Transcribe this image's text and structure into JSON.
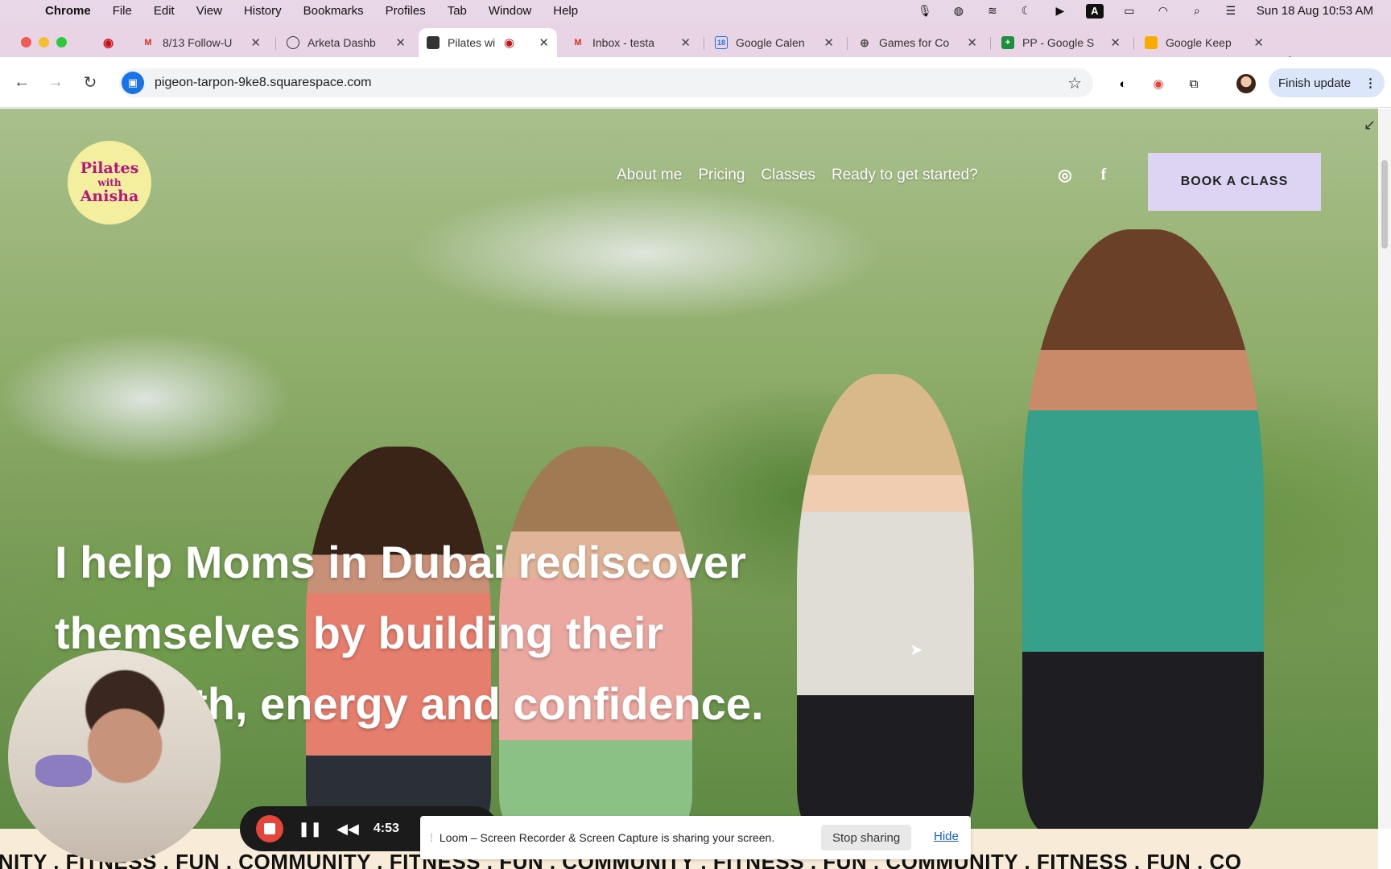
{
  "menubar": {
    "app": "Chrome",
    "items": [
      "File",
      "Edit",
      "View",
      "History",
      "Bookmarks",
      "Profiles",
      "Tab",
      "Window",
      "Help"
    ],
    "clock": "Sun 18 Aug  10:53 AM"
  },
  "tabs": [
    {
      "title": "",
      "icon": "record-icon"
    },
    {
      "title": "8/13 Follow-U",
      "icon": "gmail-icon"
    },
    {
      "title": "Arketa Dashb",
      "icon": "arketa-icon"
    },
    {
      "title": "Pilates wi",
      "icon": "squarespace-icon",
      "active": true
    },
    {
      "title": "Inbox - testa",
      "icon": "gmail-icon"
    },
    {
      "title": "Google Calen",
      "icon": "calendar-icon"
    },
    {
      "title": "Games for Co",
      "icon": "globe-icon"
    },
    {
      "title": "PP - Google S",
      "icon": "sheets-icon"
    },
    {
      "title": "Google Keep",
      "icon": "keep-icon"
    }
  ],
  "toolbar": {
    "url": "pigeon-tarpon-9ke8.squarespace.com",
    "finish_update": "Finish update"
  },
  "site": {
    "logo": {
      "line1": "Pilates",
      "line2": "with",
      "line3": "Anisha"
    },
    "nav": [
      "About me",
      "Pricing",
      "Classes",
      "Ready to get started?"
    ],
    "book_button": "BOOK A CLASS",
    "headline_1": "I help Moms in Dubai rediscover",
    "headline_2": "themselves by building their",
    "headline_3": "strength, energy and confidence.",
    "marquee": "INITY . FITNESS . FUN . COMMUNITY . FITNESS . FUN . COMMUNITY . FITNESS . FUN . COMMUNITY . FITNESS . FUN . CO"
  },
  "loom": {
    "timer": "4:53",
    "share_message": "Loom – Screen Recorder & Screen Capture is sharing your screen.",
    "stop_sharing": "Stop sharing",
    "hide": "Hide"
  },
  "colors": {
    "menubar_bg": "#e8d7e6",
    "tabstrip_bg": "#e9d4e5",
    "book_button_bg": "#ddd3f2",
    "logo_bg": "#f4ef9e",
    "logo_text": "#b5177b",
    "marquee_bg": "#f8ecd8"
  }
}
